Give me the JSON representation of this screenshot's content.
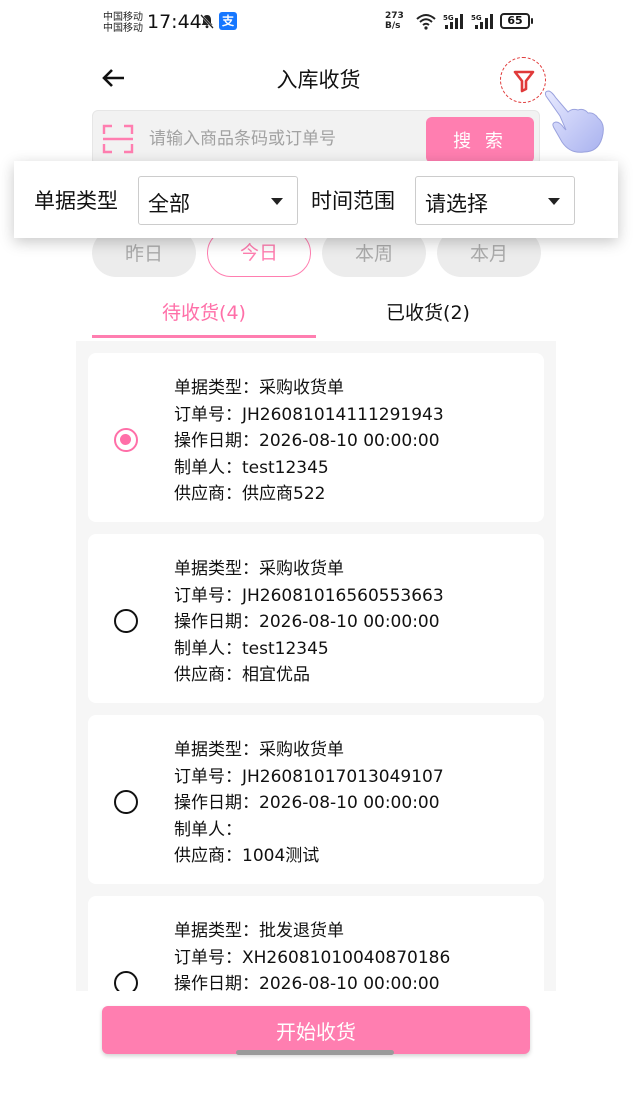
{
  "status_bar": {
    "carrier_1": "中国移动",
    "carrier_2": "中国移动",
    "time": "17:44",
    "alipay": "支",
    "net_speed_value": "273",
    "net_speed_unit": "B/s",
    "battery": "65"
  },
  "header": {
    "title": "入库收货"
  },
  "search": {
    "placeholder": "请输入商品条码或订单号",
    "button_label": "搜 索"
  },
  "filter": {
    "doc_type_label": "单据类型",
    "doc_type_value": "全部",
    "time_range_label": "时间范围",
    "time_range_value": "请选择"
  },
  "date_chips": [
    "昨日",
    "今日",
    "本周",
    "本月"
  ],
  "active_chip": "今日",
  "tabs": {
    "pending": "待收货(4)",
    "received": "已收货(2)"
  },
  "orders": [
    {
      "selected": true,
      "doc_type": "单据类型：采购收货单",
      "order_no": "订单号：JH26081014111291943",
      "date": "操作日期：2026-08-10 00:00:00",
      "maker": "制单人：test12345",
      "supplier": "供应商：供应商522"
    },
    {
      "selected": false,
      "doc_type": "单据类型：采购收货单",
      "order_no": "订单号：JH26081016560553663",
      "date": "操作日期：2026-08-10 00:00:00",
      "maker": "制单人：test12345",
      "supplier": "供应商：相宜优品"
    },
    {
      "selected": false,
      "doc_type": "单据类型：采购收货单",
      "order_no": "订单号：JH26081017013049107",
      "date": "操作日期：2026-08-10 00:00:00",
      "maker": "制单人：",
      "supplier": "供应商：1004测试"
    },
    {
      "selected": false,
      "doc_type": "单据类型：批发退货单",
      "order_no": "订单号：XH26081010040870186",
      "date": "操作日期：2026-08-10 00:00:00",
      "maker": "",
      "supplier": ""
    }
  ],
  "footer": {
    "start_button": "开始收货"
  },
  "colors": {
    "accent": "#ff7eb0",
    "accent_text": "#ff6fa8",
    "filter_icon": "#e03a3a"
  }
}
